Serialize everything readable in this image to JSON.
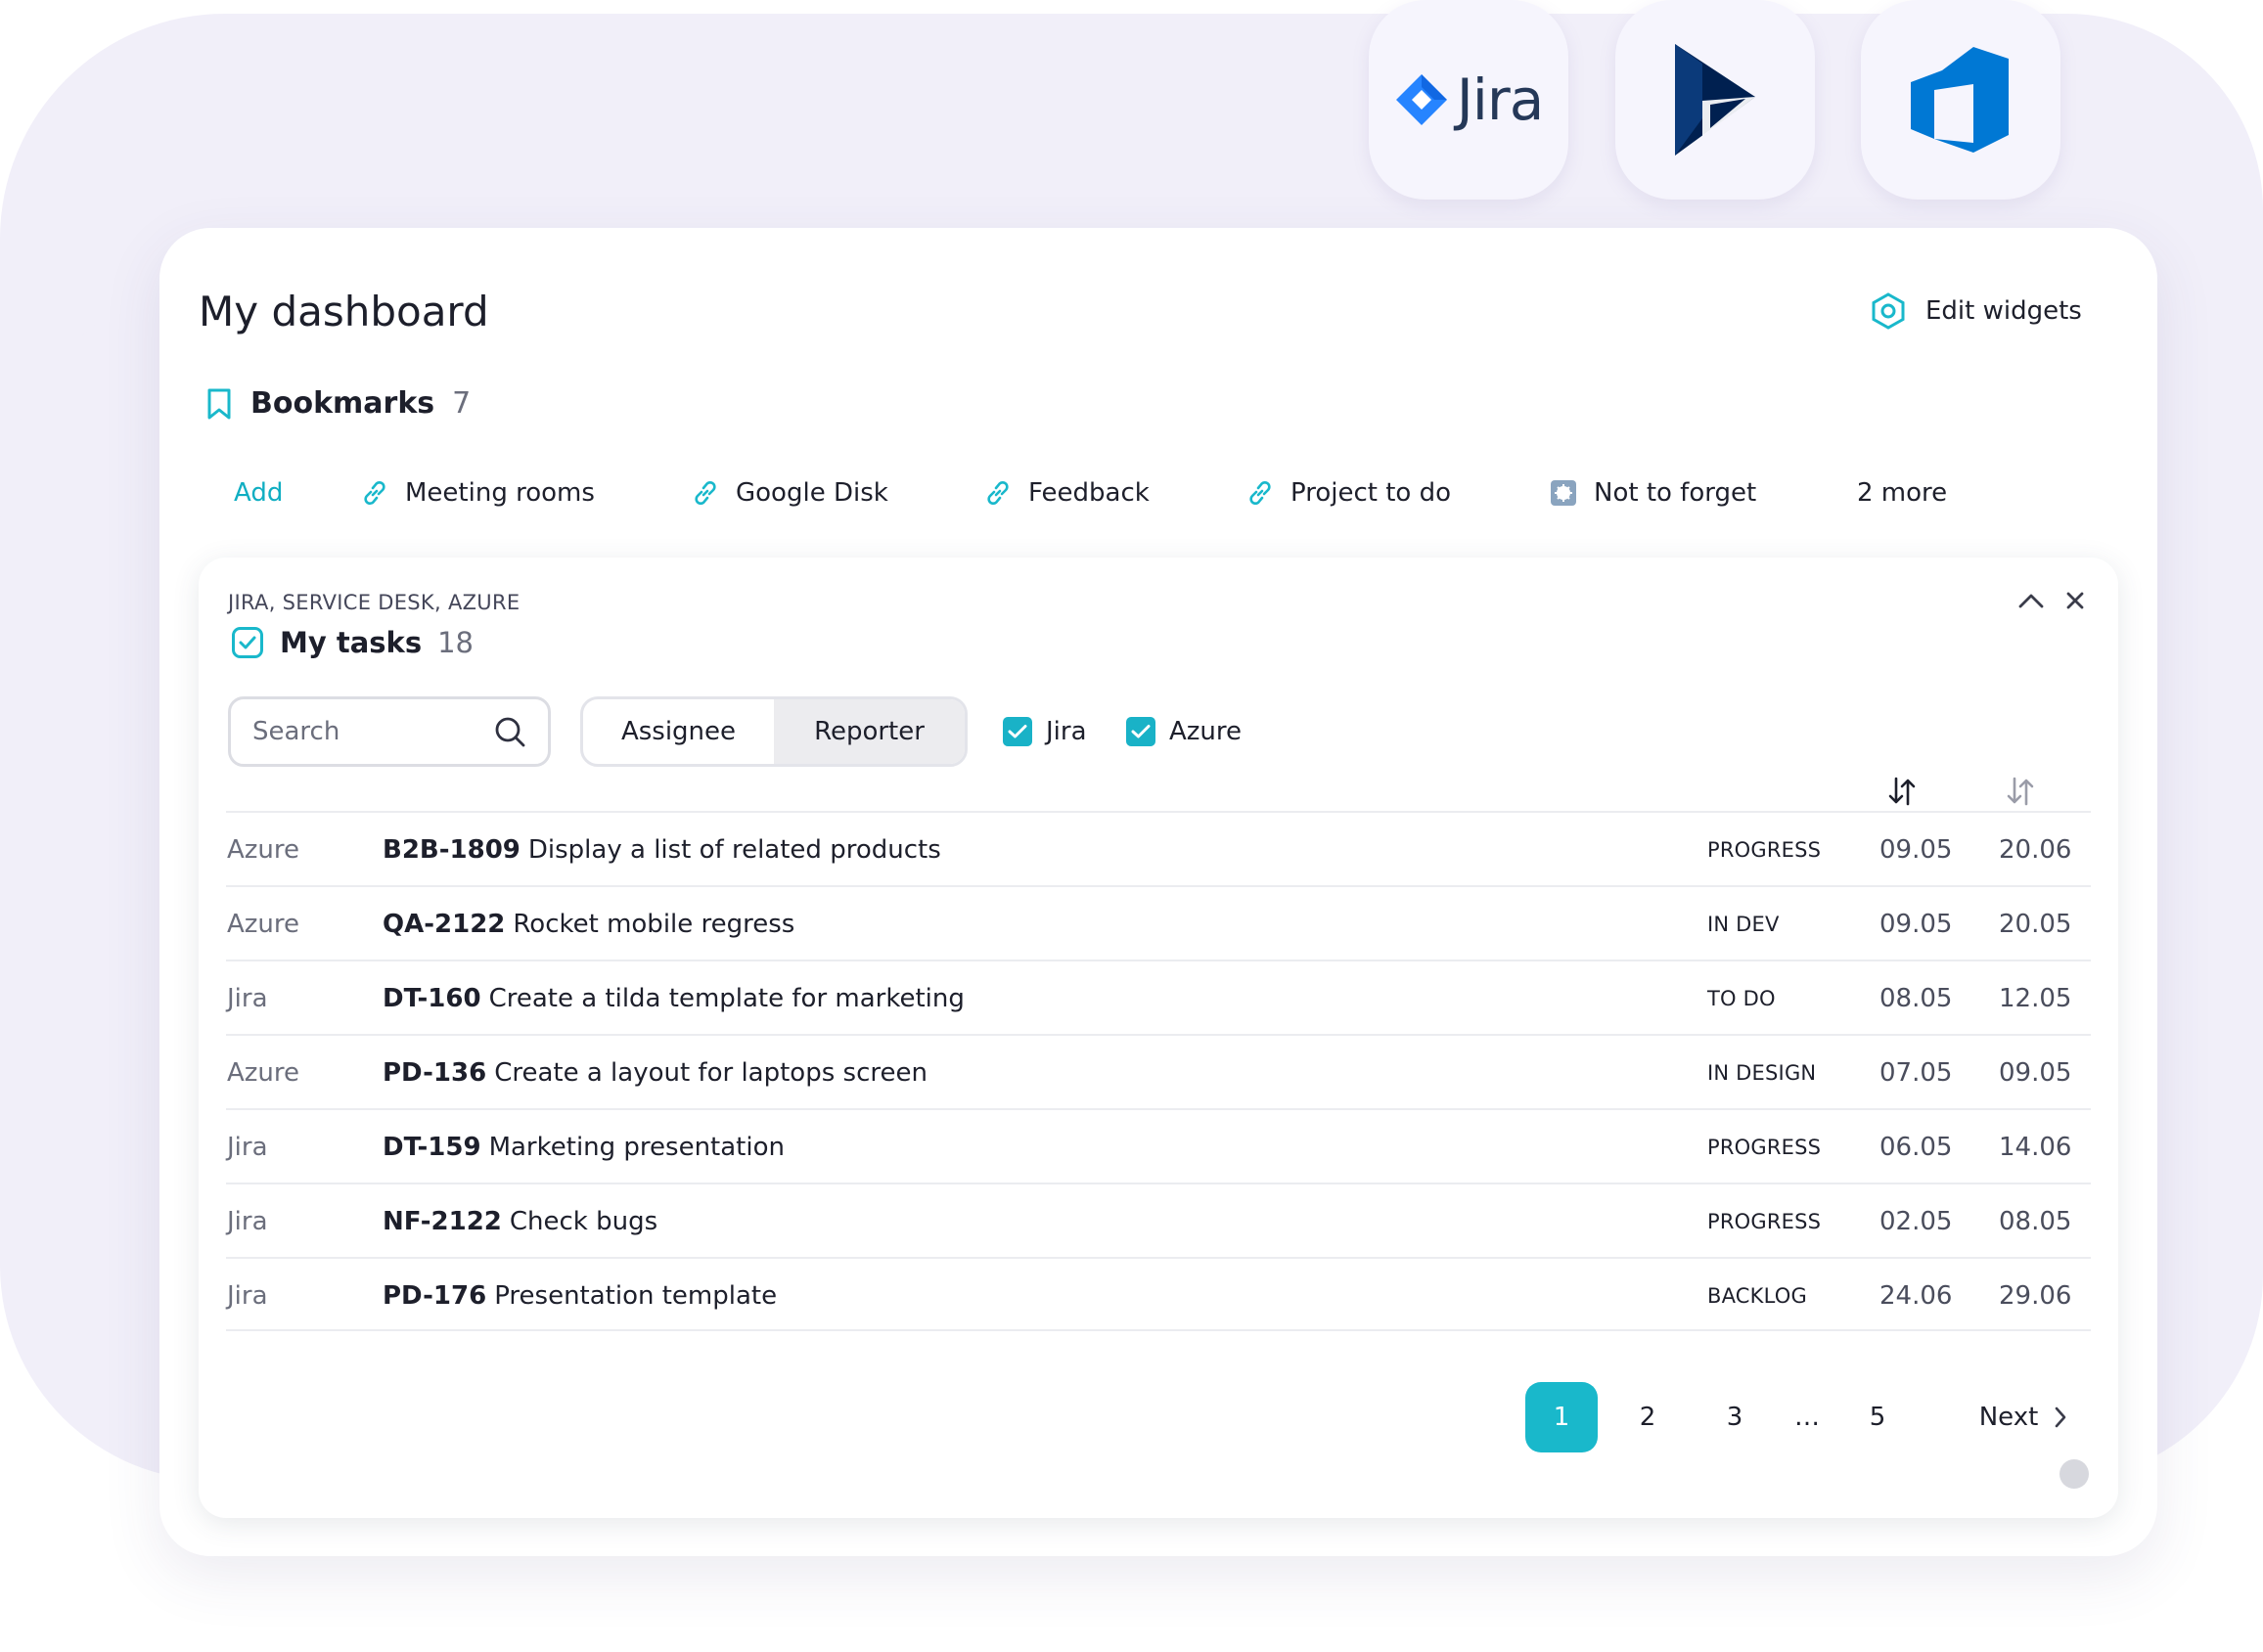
{
  "integrations": {
    "jira_word": "Jira",
    "dynamics_icon": "dynamics-logo-icon",
    "azure_icon": "azure-devops-logo-icon"
  },
  "page": {
    "title": "My dashboard",
    "edit_widgets_label": "Edit widgets"
  },
  "bookmarks": {
    "title": "Bookmarks",
    "count": "7",
    "add_label": "Add",
    "items": [
      {
        "label": "Meeting rooms",
        "icon": "link-icon"
      },
      {
        "label": "Google Disk",
        "icon": "link-icon"
      },
      {
        "label": "Feedback",
        "icon": "link-icon"
      },
      {
        "label": "Project to do",
        "icon": "link-icon"
      },
      {
        "label": "Not to forget",
        "icon": "note-icon"
      }
    ],
    "more_label": "2 more"
  },
  "tasks_widget": {
    "sources": "JIRA, SERVICE DESK, AZURE",
    "title": "My tasks",
    "count": "18",
    "search_placeholder": "Search",
    "segments": [
      "Assignee",
      "Reporter"
    ],
    "active_segment": "Reporter",
    "filters": [
      {
        "label": "Jira",
        "checked": true
      },
      {
        "label": "Azure",
        "checked": true
      }
    ],
    "rows": [
      {
        "source": "Azure",
        "key": "B2B-1809",
        "name": "Display a list of related products",
        "status": "PROGRESS",
        "start": "09.05",
        "end": "20.06"
      },
      {
        "source": "Azure",
        "key": "QA-2122",
        "name": "Rocket mobile regress",
        "status": "IN DEV",
        "start": "09.05",
        "end": "20.05"
      },
      {
        "source": "Jira",
        "key": "DT-160",
        "name": "Create a tilda template for marketing",
        "status": "TO DO",
        "start": "08.05",
        "end": "12.05"
      },
      {
        "source": "Azure",
        "key": "PD-136",
        "name": "Create a layout for laptops screen",
        "status": "IN DESIGN",
        "start": "07.05",
        "end": "09.05"
      },
      {
        "source": "Jira",
        "key": "DT-159",
        "name": "Marketing presentation",
        "status": "PROGRESS",
        "start": "06.05",
        "end": "14.06"
      },
      {
        "source": "Jira",
        "key": "NF-2122",
        "name": "Check bugs",
        "status": "PROGRESS",
        "start": "02.05",
        "end": "08.05"
      },
      {
        "source": "Jira",
        "key": "PD-176",
        "name": "Presentation template",
        "status": "BACKLOG",
        "start": "24.06",
        "end": "29.06"
      }
    ],
    "pagination": {
      "pages": [
        "1",
        "2",
        "3",
        "…",
        "5"
      ],
      "active": "1",
      "next_label": "Next"
    }
  },
  "colors": {
    "accent": "#19b8cb",
    "background_blob": "#f1eff9",
    "jira_blue": "#2684ff",
    "dynamics_navy": "#002050",
    "azure_blue": "#0078d4"
  }
}
